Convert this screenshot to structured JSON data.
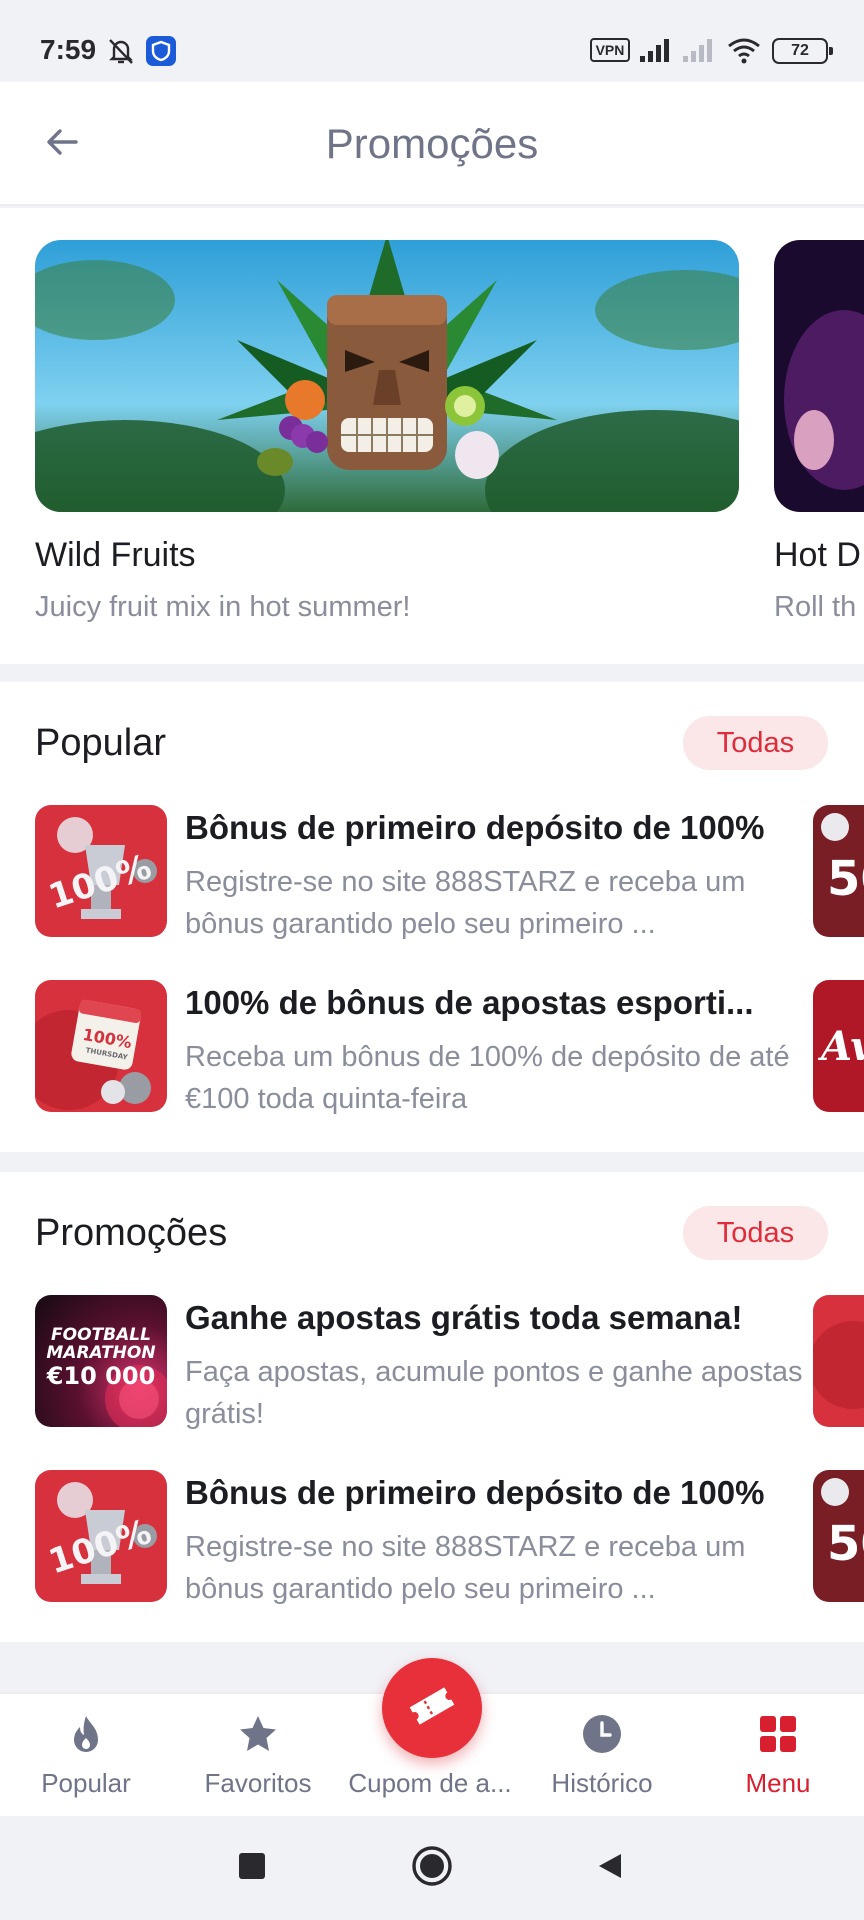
{
  "status_bar": {
    "time": "7:59",
    "vpn": "VPN",
    "battery": "72"
  },
  "header": {
    "title": "Promoções",
    "back_icon": "arrow-left-icon"
  },
  "banners": [
    {
      "title": "Wild Fruits",
      "subtitle": "Juicy fruit mix in hot summer!"
    },
    {
      "title": "Hot D",
      "subtitle": "Roll th"
    }
  ],
  "popular": {
    "title": "Popular",
    "all_label": "Todas",
    "items": [
      {
        "title": "Bônus de primeiro depósito de 100%",
        "description": "Registre-se no site 888STARZ e receba um bônus garantido pelo seu primeiro ...",
        "thumb_text": "100%"
      },
      {
        "title": "100% de bônus de apostas esporti...",
        "description": "Receba um bônus de 100% de depósito de até €100 toda quinta-feira",
        "thumb_text": "100%",
        "thumb_subtext": "THURSDAY"
      }
    ]
  },
  "promotions": {
    "title": "Promoções",
    "all_label": "Todas",
    "items": [
      {
        "title": "Ganhe apostas grátis toda semana!",
        "description": "Faça apostas, acumule pontos e ganhe apostas grátis!",
        "thumb_line1": "FOOTBALL",
        "thumb_line2": "MARATHON",
        "thumb_line3": "€10 000"
      },
      {
        "title": "Bônus de primeiro depósito de 100%",
        "description": "Registre-se no site 888STARZ e receba um bônus garantido pelo seu primeiro ...",
        "thumb_text": "100%"
      }
    ]
  },
  "bottom_nav": {
    "items": [
      {
        "label": "Popular",
        "icon": "flame-icon"
      },
      {
        "label": "Favoritos",
        "icon": "star-icon"
      },
      {
        "label": "Cupom de a...",
        "icon": "ticket-icon"
      },
      {
        "label": "Histórico",
        "icon": "clock-icon"
      },
      {
        "label": "Menu",
        "icon": "grid-icon"
      }
    ],
    "active": "Menu"
  },
  "colors": {
    "accent": "#d81f2f",
    "todas_bg": "#fbe6e8",
    "muted_text": "#8a8d9c",
    "title_text": "#6f7489"
  }
}
